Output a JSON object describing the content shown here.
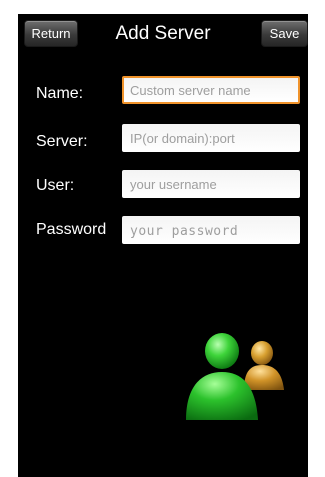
{
  "header": {
    "title": "Add Server",
    "return_label": "Return",
    "save_label": "Save"
  },
  "form": {
    "name": {
      "label": "Name:",
      "placeholder": "Custom server name",
      "value": ""
    },
    "server": {
      "label": "Server:",
      "placeholder": "IP(or domain):port",
      "value": ""
    },
    "user": {
      "label": "User:",
      "placeholder": "your username",
      "value": ""
    },
    "password": {
      "label": "Password",
      "placeholder": "your password",
      "value": ""
    }
  },
  "illustration": {
    "icon": "users-icon"
  },
  "colors": {
    "background": "#000000",
    "focus_border": "#f0932b",
    "user_primary": "#2fbf2f",
    "user_secondary": "#d89a2a"
  }
}
